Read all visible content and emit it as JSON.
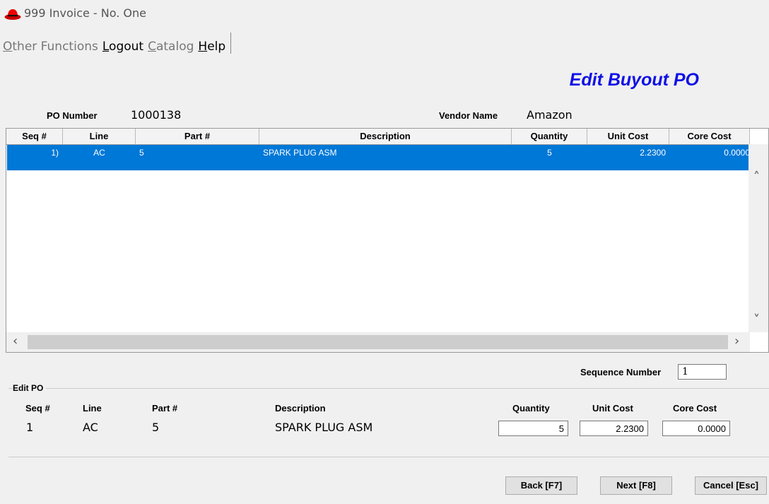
{
  "window": {
    "title": "999 Invoice - No. One",
    "app_icon": "red-hat-icon"
  },
  "menu": {
    "items": [
      {
        "label": "Other Functions",
        "dim": true
      },
      {
        "label": "Logout",
        "dim": false
      },
      {
        "label": "Catalog",
        "dim": true
      },
      {
        "label": "Help",
        "dim": false
      }
    ]
  },
  "page": {
    "heading": "Edit Buyout PO",
    "heading_color": "#1010e8"
  },
  "po": {
    "number_label": "PO Number",
    "number_value": "1000138",
    "vendor_label": "Vendor Name",
    "vendor_value": "Amazon"
  },
  "table": {
    "columns": [
      "Seq #",
      "Line",
      "Part #",
      "Description",
      "Quantity",
      "Unit Cost",
      "Core Cost"
    ],
    "rows": [
      {
        "seq": "1)",
        "line": "AC",
        "part": "5",
        "description": "SPARK PLUG ASM",
        "quantity": "5",
        "unit_cost": "2.2300",
        "core_cost": "0.0000",
        "selected": true
      }
    ],
    "selected_row_color": "#0078d7"
  },
  "sequence": {
    "label": "Sequence Number",
    "value": "1"
  },
  "edit_po": {
    "legend": "Edit PO",
    "headers": {
      "seq": "Seq #",
      "line": "Line",
      "part": "Part #",
      "description": "Description",
      "quantity": "Quantity",
      "unit_cost": "Unit Cost",
      "core_cost": "Core Cost"
    },
    "values": {
      "seq": "1",
      "line": "AC",
      "part": "5",
      "description": "SPARK PLUG ASM",
      "quantity": "5",
      "unit_cost": "2.2300",
      "core_cost": "0.0000"
    }
  },
  "buttons": {
    "back": "Back [F7]",
    "next": "Next [F8]",
    "cancel": "Cancel [Esc]"
  }
}
